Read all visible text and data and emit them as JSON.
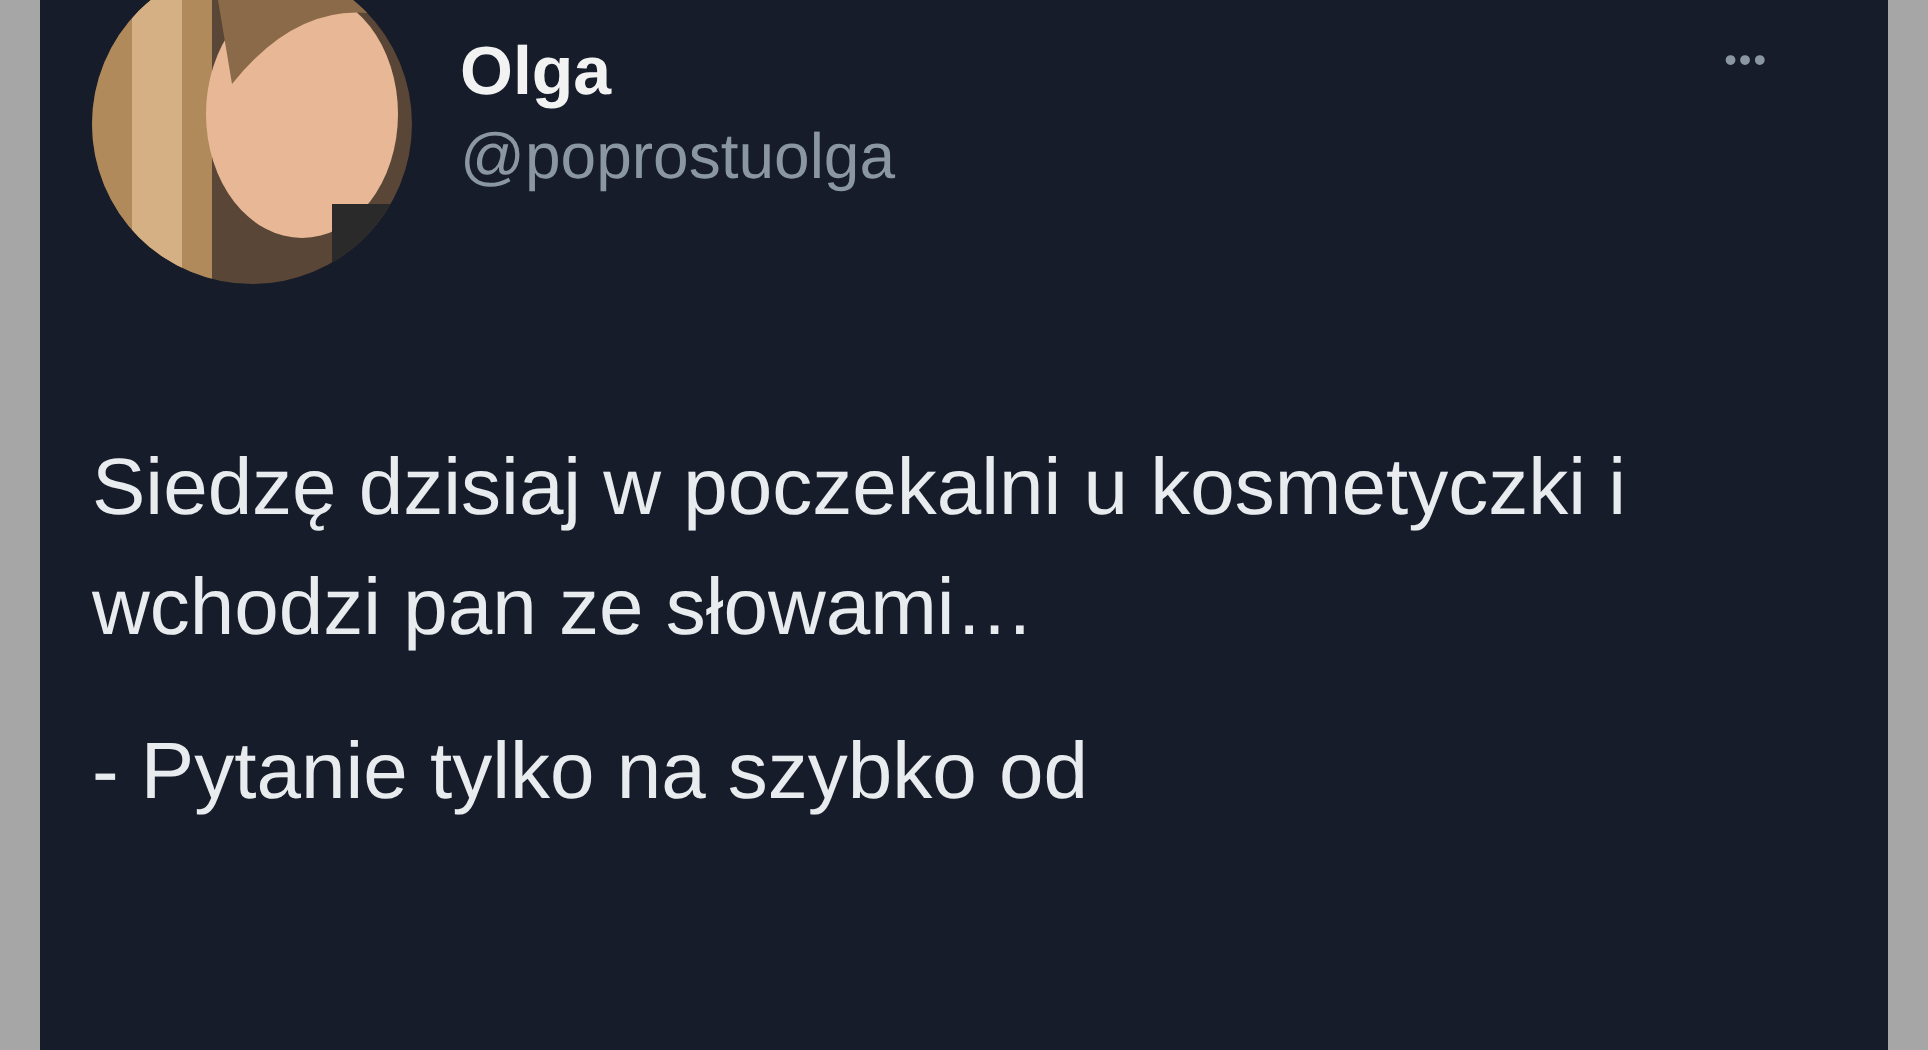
{
  "tweet": {
    "author": {
      "name": "Olga",
      "handle": "@poprostuolga"
    },
    "menu": "•••",
    "paragraphs": [
      "Siedzę dzisiaj w poczekalni u kosmetyczki i wchodzi pan ze słowami…",
      "- Pytanie tylko na szybko od"
    ]
  }
}
